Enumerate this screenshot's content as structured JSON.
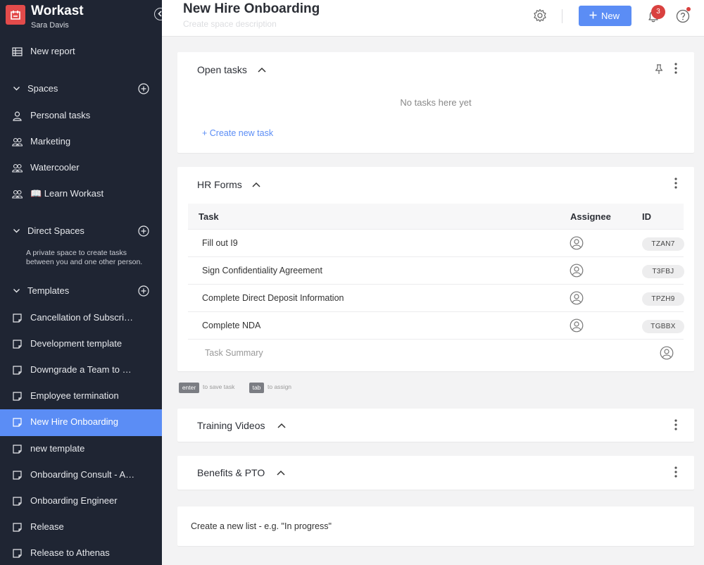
{
  "app": {
    "name": "Workast",
    "user": "Sara Davis"
  },
  "sidebar": {
    "new_report": "New report",
    "spaces_label": "Spaces",
    "spaces": [
      "Personal tasks",
      "Marketing",
      "Watercooler",
      "📖 Learn Workast"
    ],
    "direct_label": "Direct Spaces",
    "direct_desc": "A private space to create tasks between you and one other person.",
    "templates_label": "Templates",
    "templates": [
      "Cancellation of Subscription",
      "Development template",
      "Downgrade a Team to Free",
      "Employee termination",
      "New Hire Onboarding",
      "new template",
      "Onboarding Consult - Admin",
      "Onboarding Engineer",
      "Release",
      "Release to Athenas"
    ],
    "active_template": "New Hire Onboarding"
  },
  "header": {
    "title": "New Hire Onboarding",
    "description_placeholder": "Create space description",
    "new_label": "New",
    "notification_count": "3"
  },
  "lists": {
    "open_tasks": {
      "title": "Open tasks",
      "empty": "No tasks here yet",
      "create": "+ Create new task"
    },
    "hr_forms": {
      "title": "HR Forms",
      "columns": {
        "task": "Task",
        "assignee": "Assignee",
        "id": "ID"
      },
      "rows": [
        {
          "task": "Fill out I9",
          "id": "TZAN7"
        },
        {
          "task": "Sign Confidentiality Agreement",
          "id": "T3FBJ"
        },
        {
          "task": "Complete Direct Deposit Information",
          "id": "TPZH9"
        },
        {
          "task": "Complete NDA",
          "id": "TGBBX"
        }
      ],
      "summary_placeholder": "Task Summary"
    },
    "hints": {
      "enter_key": "enter",
      "enter_text": "to save task",
      "tab_key": "tab",
      "tab_text": "to assign"
    },
    "training_videos": {
      "title": "Training Videos"
    },
    "benefits": {
      "title": "Benefits & PTO"
    },
    "new_list_placeholder": "Create a new list - e.g. \"In progress\""
  },
  "colors": {
    "sidebar_bg": "#1f2533",
    "accent": "#5b8df5",
    "badge": "#d9413f"
  }
}
